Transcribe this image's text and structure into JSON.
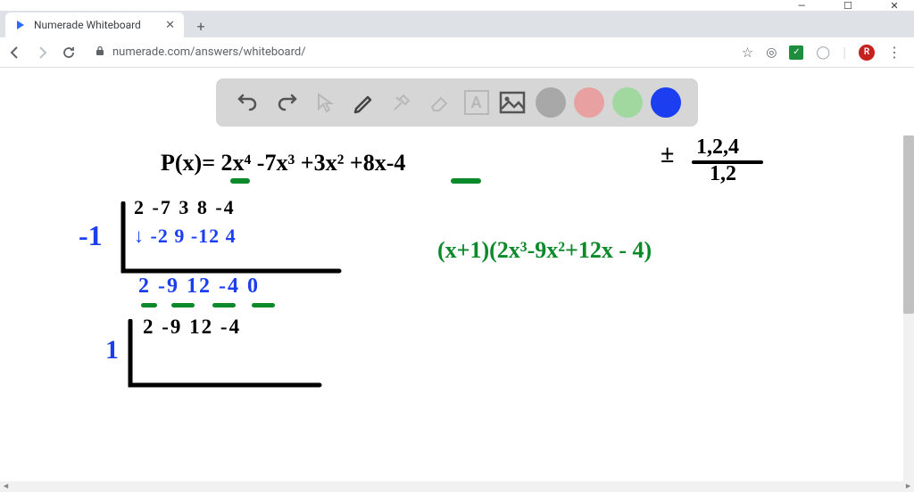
{
  "window": {
    "minimize": "—",
    "maximize": "☐",
    "close": "✕"
  },
  "tab": {
    "title": "Numerade Whiteboard",
    "close": "✕",
    "new": "+"
  },
  "nav": {
    "back": "←",
    "forward": "→",
    "reload": "⟳"
  },
  "url": {
    "lock": "🔒",
    "text": "numerade.com/answers/whiteboard/"
  },
  "ext": {
    "star": "☆",
    "shield": "◎",
    "check": "✓",
    "headset": "◯",
    "avatar": "R",
    "menu": "⋮"
  },
  "toolbar": {
    "undo": "undo",
    "redo": "redo",
    "cursor": "cursor",
    "pen": "pen",
    "tools": "tools",
    "eraser": "eraser",
    "text": "A",
    "image": "image",
    "colors": {
      "gray": "#a8a8a8",
      "red": "#e8a0a0",
      "green": "#a0d8a0",
      "blue": "#1a3ef0"
    }
  },
  "board": {
    "px": "P(x)= 2x⁴ -7x³ +3x² +8x-4",
    "factors_num": "1,2,4",
    "factors_den": "1,2",
    "pm": "±",
    "syn1_divisor": "-1",
    "syn1_row1": "2   -7   3    8   -4",
    "syn1_row2": "↓   -2   9  -12   4",
    "syn1_row3": "2   -9   12  -4   0",
    "factored": "(x+1)(2x³-9x²+12x - 4)",
    "syn2_divisor": "1",
    "syn2_row1": "2    -9   12   -4"
  }
}
